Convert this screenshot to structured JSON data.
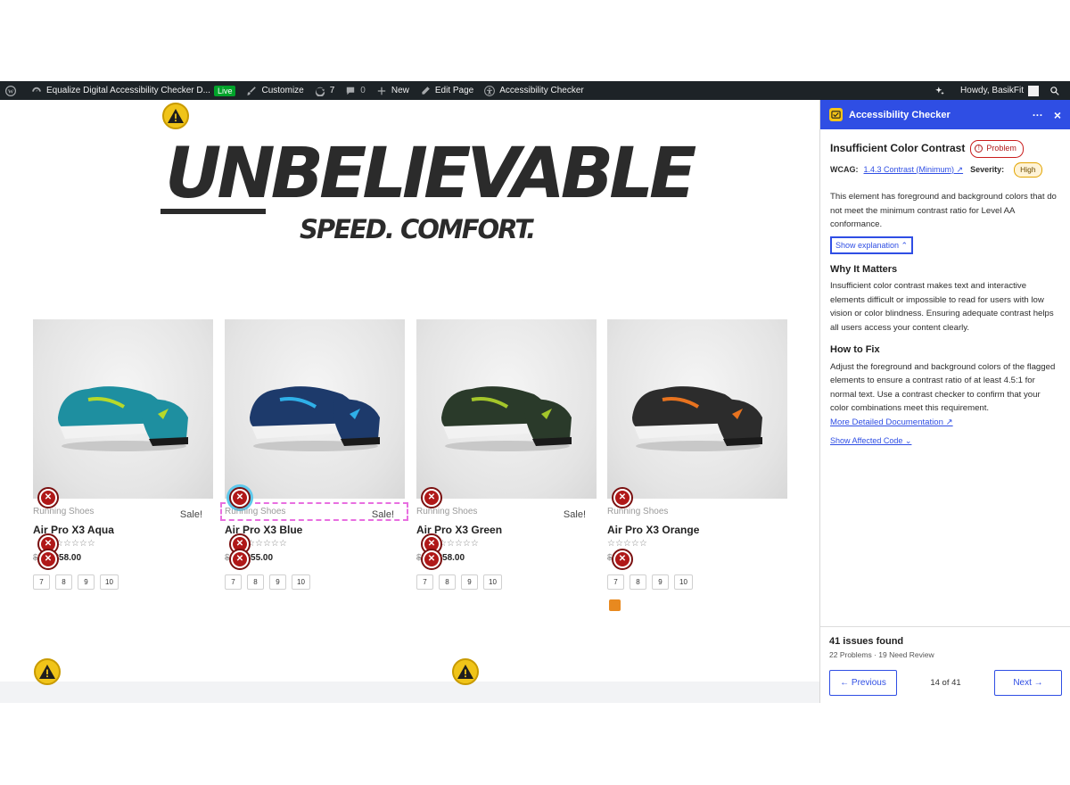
{
  "adminbar": {
    "site_name": "Equalize Digital Accessibility Checker D...",
    "live_badge": "Live",
    "customize": "Customize",
    "updates_count": "7",
    "comments_count": "0",
    "new_label": "New",
    "edit_page": "Edit Page",
    "accessibility_checker": "Accessibility Checker",
    "howdy": "Howdy, BasikFit"
  },
  "hero": {
    "title": "UNBELIEVABLE",
    "subtitle": "SPEED. COMFORT."
  },
  "products": [
    {
      "category": "Running Shoes",
      "sale": "Sale!",
      "name": "Air Pro X3 Aqua",
      "stars": "☆☆☆☆☆",
      "old_price": "$",
      "price": "$58.00",
      "sizes": [
        "7",
        "8",
        "9",
        "10"
      ],
      "shoe_color": "#1e8fa0",
      "accent_color": "#b7d92a"
    },
    {
      "category": "Running Shoes",
      "sale": "Sale!",
      "name": "Air Pro X3 Blue",
      "stars": "☆☆☆☆☆",
      "old_price": "$",
      "price": "$55.00",
      "sizes": [
        "7",
        "8",
        "9",
        "10"
      ],
      "shoe_color": "#1d3a6b",
      "accent_color": "#2fb0e8"
    },
    {
      "category": "Running Shoes",
      "sale": "Sale!",
      "name": "Air Pro X3 Green",
      "stars": "☆☆☆☆☆",
      "old_price": "$",
      "price": "$58.00",
      "sizes": [
        "7",
        "8",
        "9",
        "10"
      ],
      "shoe_color": "#2a3a2a",
      "accent_color": "#a4c62a"
    },
    {
      "category": "Running Shoes",
      "sale": "",
      "name": "Air Pro X3 Orange",
      "stars": "☆☆☆☆☆",
      "old_price": "$",
      "price": "",
      "sizes": [
        "7",
        "8",
        "9",
        "10"
      ],
      "shoe_color": "#2c2c2c",
      "accent_color": "#e8731f"
    }
  ],
  "panel": {
    "header_title": "Accessibility Checker",
    "more": "···",
    "close": "×",
    "issue_title": "Insufficient Color Contrast",
    "issue_type": "Problem",
    "wcag_label": "WCAG:",
    "wcag_link": "1.4.3 Contrast (Minimum) ↗",
    "severity_label": "Severity:",
    "severity": "High",
    "description": "This element has foreground and background colors that do not meet the minimum contrast ratio for Level AA conformance.",
    "show_explanation": "Show explanation ⌃",
    "why_heading": "Why It Matters",
    "why_text": "Insufficient color contrast makes text and interactive elements difficult or impossible to read for users with low vision or color blindness. Ensuring adequate contrast helps all users access your content clearly.",
    "fix_heading": "How to Fix",
    "fix_text": "Adjust the foreground and background colors of the flagged elements to ensure a contrast ratio of at least 4.5:1 for normal text. Use a contrast checker to confirm that your color combinations meet this requirement.",
    "docs_link": "More Detailed Documentation ↗",
    "affected_code": "Show Affected Code ⌄",
    "issues_found": "41 issues found",
    "issues_breakdown": "22 Problems · 19 Need Review",
    "prev": "← Previous",
    "position": "14 of 41",
    "next": "Next →"
  },
  "colors": {
    "accent": "#2f4ee4",
    "adminbar_bg": "#1d2327",
    "error": "#b01818",
    "warning": "#f0c419",
    "highlight": "#e86fe0"
  }
}
